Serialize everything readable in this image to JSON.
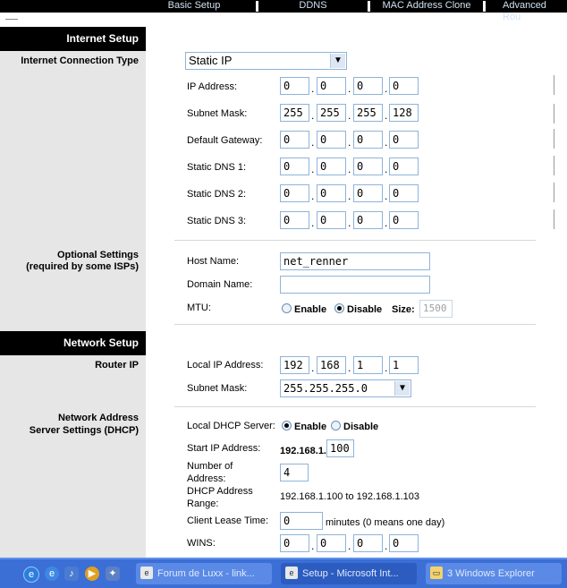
{
  "nav": {
    "tabs": [
      "Basic Setup",
      "DDNS",
      "MAC Address Clone",
      "Advanced Rou"
    ]
  },
  "sections": {
    "internet_setup": "Internet Setup",
    "network_setup": "Network Setup"
  },
  "labels": {
    "connection_type": "Internet Connection Type",
    "optional_1": "Optional Settings",
    "optional_2": "(required by some ISPs)",
    "router_ip": "Router IP",
    "dhcp_1": "Network Address",
    "dhcp_2": "Server Settings (DHCP)"
  },
  "internet": {
    "connection_type": "Static IP",
    "fields": [
      {
        "label": "IP Address:",
        "octets": [
          "0",
          "0",
          "0",
          "0"
        ]
      },
      {
        "label": "Subnet Mask:",
        "octets": [
          "255",
          "255",
          "255",
          "128"
        ]
      },
      {
        "label": "Default Gateway:",
        "octets": [
          "0",
          "0",
          "0",
          "0"
        ]
      },
      {
        "label": "Static DNS 1:",
        "octets": [
          "0",
          "0",
          "0",
          "0"
        ]
      },
      {
        "label": "Static DNS 2:",
        "octets": [
          "0",
          "0",
          "0",
          "0"
        ]
      },
      {
        "label": "Static DNS 3:",
        "octets": [
          "0",
          "0",
          "0",
          "0"
        ]
      }
    ]
  },
  "optional": {
    "host_label": "Host Name:",
    "host_value": "net_renner",
    "domain_label": "Domain Name:",
    "domain_value": "",
    "mtu_label": "MTU:",
    "enable": "Enable",
    "disable": "Disable",
    "mtu_selected": "Disable",
    "size_label": "Size:",
    "size_value": "1500"
  },
  "router": {
    "local_ip_label": "Local IP Address:",
    "local_ip": [
      "192",
      "168",
      "1",
      "1"
    ],
    "mask_label": "Subnet Mask:",
    "mask_value": "255.255.255.0"
  },
  "dhcp": {
    "server_label": "Local DHCP Server:",
    "enable": "Enable",
    "disable": "Disable",
    "selected": "Enable",
    "start_label": "Start IP Address:",
    "start_prefix": "192.168.1.",
    "start_value": "100",
    "num_label_1": "Number of",
    "num_label_2": "Address:",
    "num_value": "4",
    "range_label_1": "DHCP Address",
    "range_label_2": "Range:",
    "range_value": "192.168.1.100 to 192.168.1.103",
    "lease_label": "Client Lease Time:",
    "lease_value": "0",
    "lease_note": "minutes (0 means one day)",
    "wins_label": "WINS:",
    "wins": [
      "0",
      "0",
      "0",
      "0"
    ]
  },
  "taskbar": {
    "buttons": [
      "Forum de Luxx - link...",
      "Setup - Microsoft Int...",
      "3 Windows Explorer"
    ],
    "active_index": 1
  },
  "colors": {
    "section_bg": "#000000",
    "left_bg": "#e6e6e6",
    "field_border": "#8fb3d9",
    "taskbar": "#3b6fd6"
  }
}
